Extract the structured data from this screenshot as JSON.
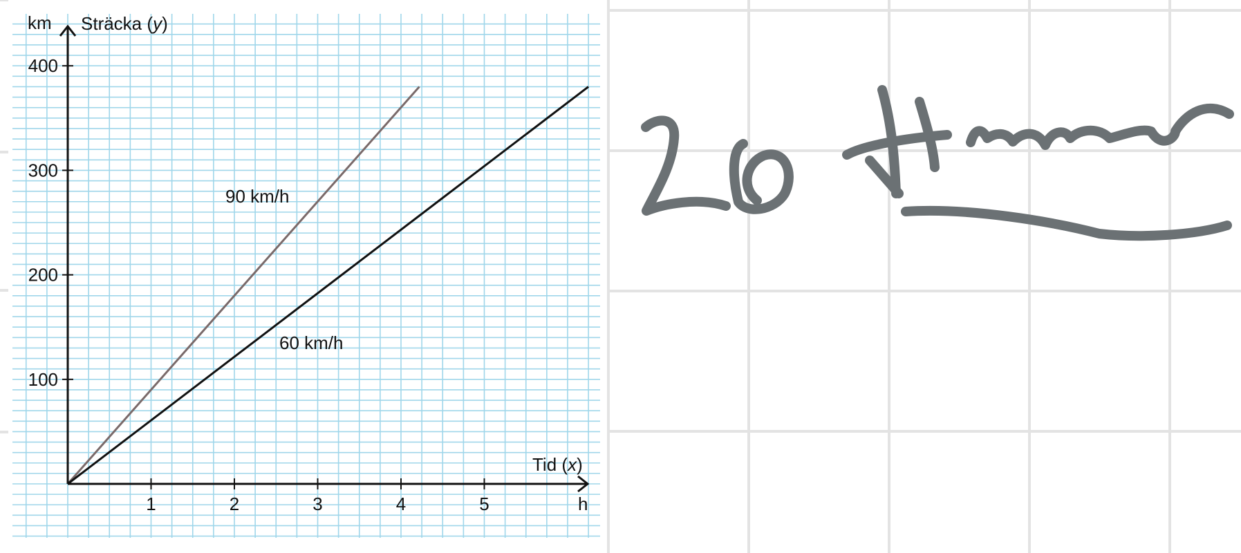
{
  "chart_data": {
    "type": "line",
    "title": "",
    "ylabel": "Sträcka",
    "ylabel_var": "y",
    "yunit": "km",
    "xlabel": "Tid",
    "xlabel_var": "x",
    "xunit": "h",
    "xlim": [
      0,
      6.25
    ],
    "ylim": [
      0,
      400
    ],
    "xticks": [
      1,
      2,
      3,
      4,
      5
    ],
    "yticks": [
      100,
      200,
      300,
      400
    ],
    "grid": true,
    "series": [
      {
        "name": "90 km/h",
        "color": "#7a6a6a",
        "x": [
          0,
          4.22
        ],
        "y": [
          0,
          380
        ]
      },
      {
        "name": "60 km/h",
        "color": "#111111",
        "x": [
          0,
          6.25
        ],
        "y": [
          0,
          380
        ]
      }
    ]
  },
  "handwriting": {
    "text": "20 timmer",
    "color": "#6b7174"
  },
  "colors": {
    "grid_minor": "#9fd6ea",
    "grid_major": "#7fc7e3",
    "page_grid": "#e3e3e3",
    "axis": "#111111"
  }
}
